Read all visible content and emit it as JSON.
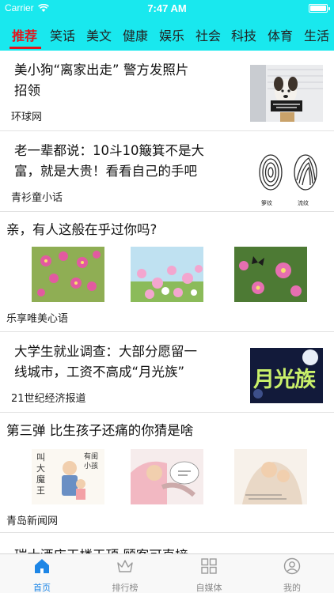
{
  "status_bar": {
    "carrier": "Carrier",
    "time": "7:47 AM"
  },
  "channels": [
    {
      "label": "推荐",
      "active": true
    },
    {
      "label": "笑话",
      "active": false
    },
    {
      "label": "美文",
      "active": false
    },
    {
      "label": "健康",
      "active": false
    },
    {
      "label": "娱乐",
      "active": false
    },
    {
      "label": "社会",
      "active": false
    },
    {
      "label": "科技",
      "active": false
    },
    {
      "label": "体育",
      "active": false
    },
    {
      "label": "生活",
      "active": false
    }
  ],
  "feed": [
    {
      "title_lines": [
        "美小狗“离家出走” 警方发照片",
        "招领"
      ],
      "source": "环球网"
    },
    {
      "title_lines": [
        "老一辈都说：10斗10簸箕不是大",
        "富，就是大贵！看看自己的手吧"
      ],
      "source": "青衫童小话",
      "image_labels": [
        "箩纹",
        "流纹"
      ]
    },
    {
      "title_lines": [
        "亲，有人这般在乎过你吗?"
      ],
      "source": "乐享唯美心语"
    },
    {
      "title_lines": [
        "大学生就业调查：大部分愿留一",
        "线城市，工资不高成“月光族”"
      ],
      "source": "21世纪经济报道",
      "image_text": "月光族"
    },
    {
      "title_lines": [
        "第三弹 比生孩子还痛的你猜是啥"
      ],
      "source": "青岛新闻网",
      "image_texts": [
        "叫大魔王",
        "有闺小孩"
      ]
    },
    {
      "title_lines": [
        "瑞士酒店天楼天顶 顾客可直接"
      ]
    }
  ],
  "tabs": [
    {
      "label": "首页",
      "icon": "home-icon",
      "active": true
    },
    {
      "label": "排行榜",
      "icon": "crown-icon",
      "active": false
    },
    {
      "label": "自媒体",
      "icon": "grid-icon",
      "active": false
    },
    {
      "label": "我的",
      "icon": "profile-icon",
      "active": false
    }
  ],
  "colors": {
    "header_bg": "#19e8ee",
    "active_channel": "#e4141b",
    "active_tab": "#1e86e6",
    "inactive_tab": "#8a8a8a"
  }
}
